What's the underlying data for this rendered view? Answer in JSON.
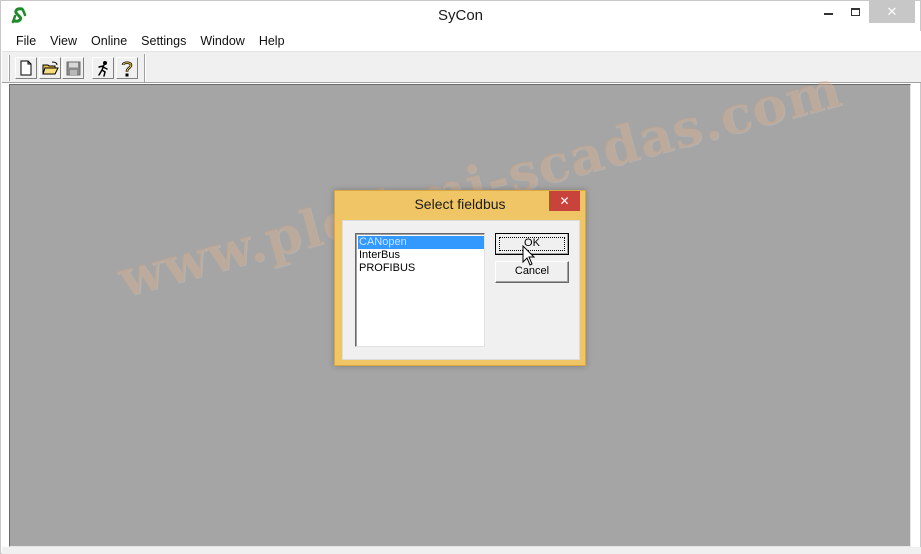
{
  "window": {
    "title": "SyCon",
    "app_icon": "sycon-logo-icon",
    "close_glyph": "✕"
  },
  "menu": {
    "items": [
      "File",
      "View",
      "Online",
      "Settings",
      "Window",
      "Help"
    ]
  },
  "toolbar": {
    "buttons": [
      "new-file-icon",
      "open-folder-icon",
      "save-disk-icon",
      "run-icon",
      "help-icon"
    ]
  },
  "dialog": {
    "title": "Select fieldbus",
    "close_glyph": "✕",
    "options": [
      "CANopen",
      "InterBus",
      "PROFIBUS"
    ],
    "selected": "CANopen",
    "ok_label": "OK",
    "cancel_label": "Cancel"
  },
  "watermark": "www.plc-hmi-scadas.com",
  "colors": {
    "workspace": "#a5a5a5",
    "dialog_frame": "#f0c566",
    "dialog_close": "#c7433b",
    "selection": "#3399ff"
  }
}
